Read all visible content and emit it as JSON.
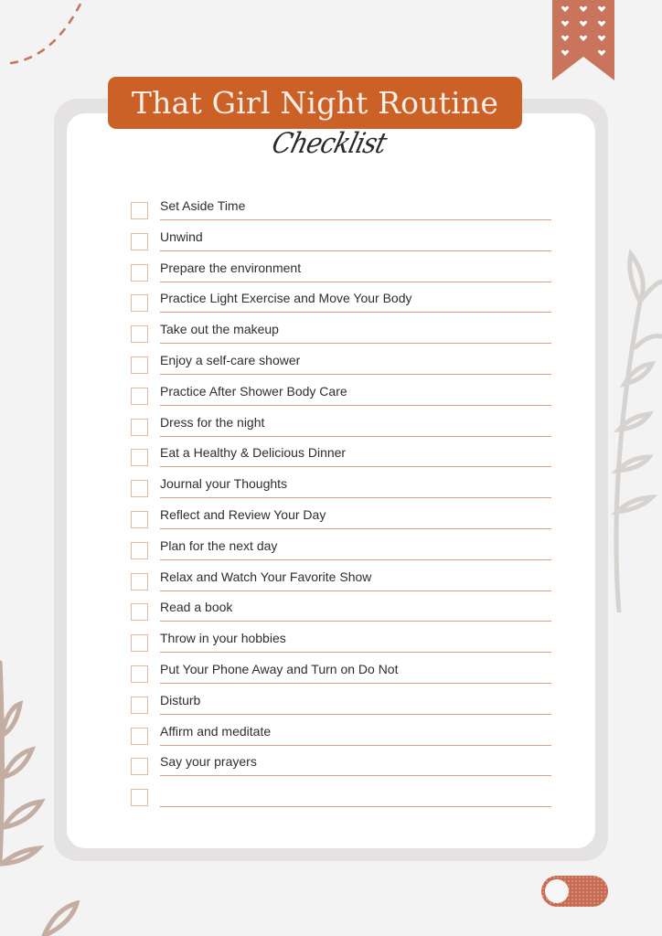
{
  "header": {
    "title": "That Girl Night Routine",
    "subtitle": "Checklist"
  },
  "colors": {
    "accent": "#cc6127",
    "bookmark": "#c9745c",
    "rule": "#d9a08c",
    "checkbox_border": "#e6b7a5",
    "leaf_gray": "#d6d2d0",
    "leaf_taupe": "#c4ada2",
    "frame": "#e4e2e3",
    "background": "#f3f3f3"
  },
  "checklist": {
    "items": [
      {
        "label": "Set Aside Time",
        "checked": false
      },
      {
        "label": "Unwind",
        "checked": false
      },
      {
        "label": "Prepare the environment",
        "checked": false
      },
      {
        "label": "Practice Light Exercise and Move Your Body",
        "checked": false
      },
      {
        "label": "Take out the makeup",
        "checked": false
      },
      {
        "label": "Enjoy a self-care shower",
        "checked": false
      },
      {
        "label": "Practice After Shower Body Care",
        "checked": false
      },
      {
        "label": "Dress for the night",
        "checked": false
      },
      {
        "label": "Eat a Healthy & Delicious Dinner",
        "checked": false
      },
      {
        "label": "Journal your Thoughts",
        "checked": false
      },
      {
        "label": "Reflect and Review Your Day",
        "checked": false
      },
      {
        "label": "Plan for the next day",
        "checked": false
      },
      {
        "label": "Relax and Watch Your Favorite Show",
        "checked": false
      },
      {
        "label": "Read a book",
        "checked": false
      },
      {
        "label": "Throw in your hobbies",
        "checked": false
      },
      {
        "label": "Put Your Phone Away and Turn on Do Not",
        "checked": false
      },
      {
        "label": "Disturb",
        "checked": false
      },
      {
        "label": "Affirm and meditate",
        "checked": false
      },
      {
        "label": "Say your prayers",
        "checked": false
      },
      {
        "label": "",
        "checked": false
      }
    ]
  },
  "decor": {
    "bookmark_icon": "heart-pattern-bookmark-icon",
    "toggle_state": "off"
  }
}
